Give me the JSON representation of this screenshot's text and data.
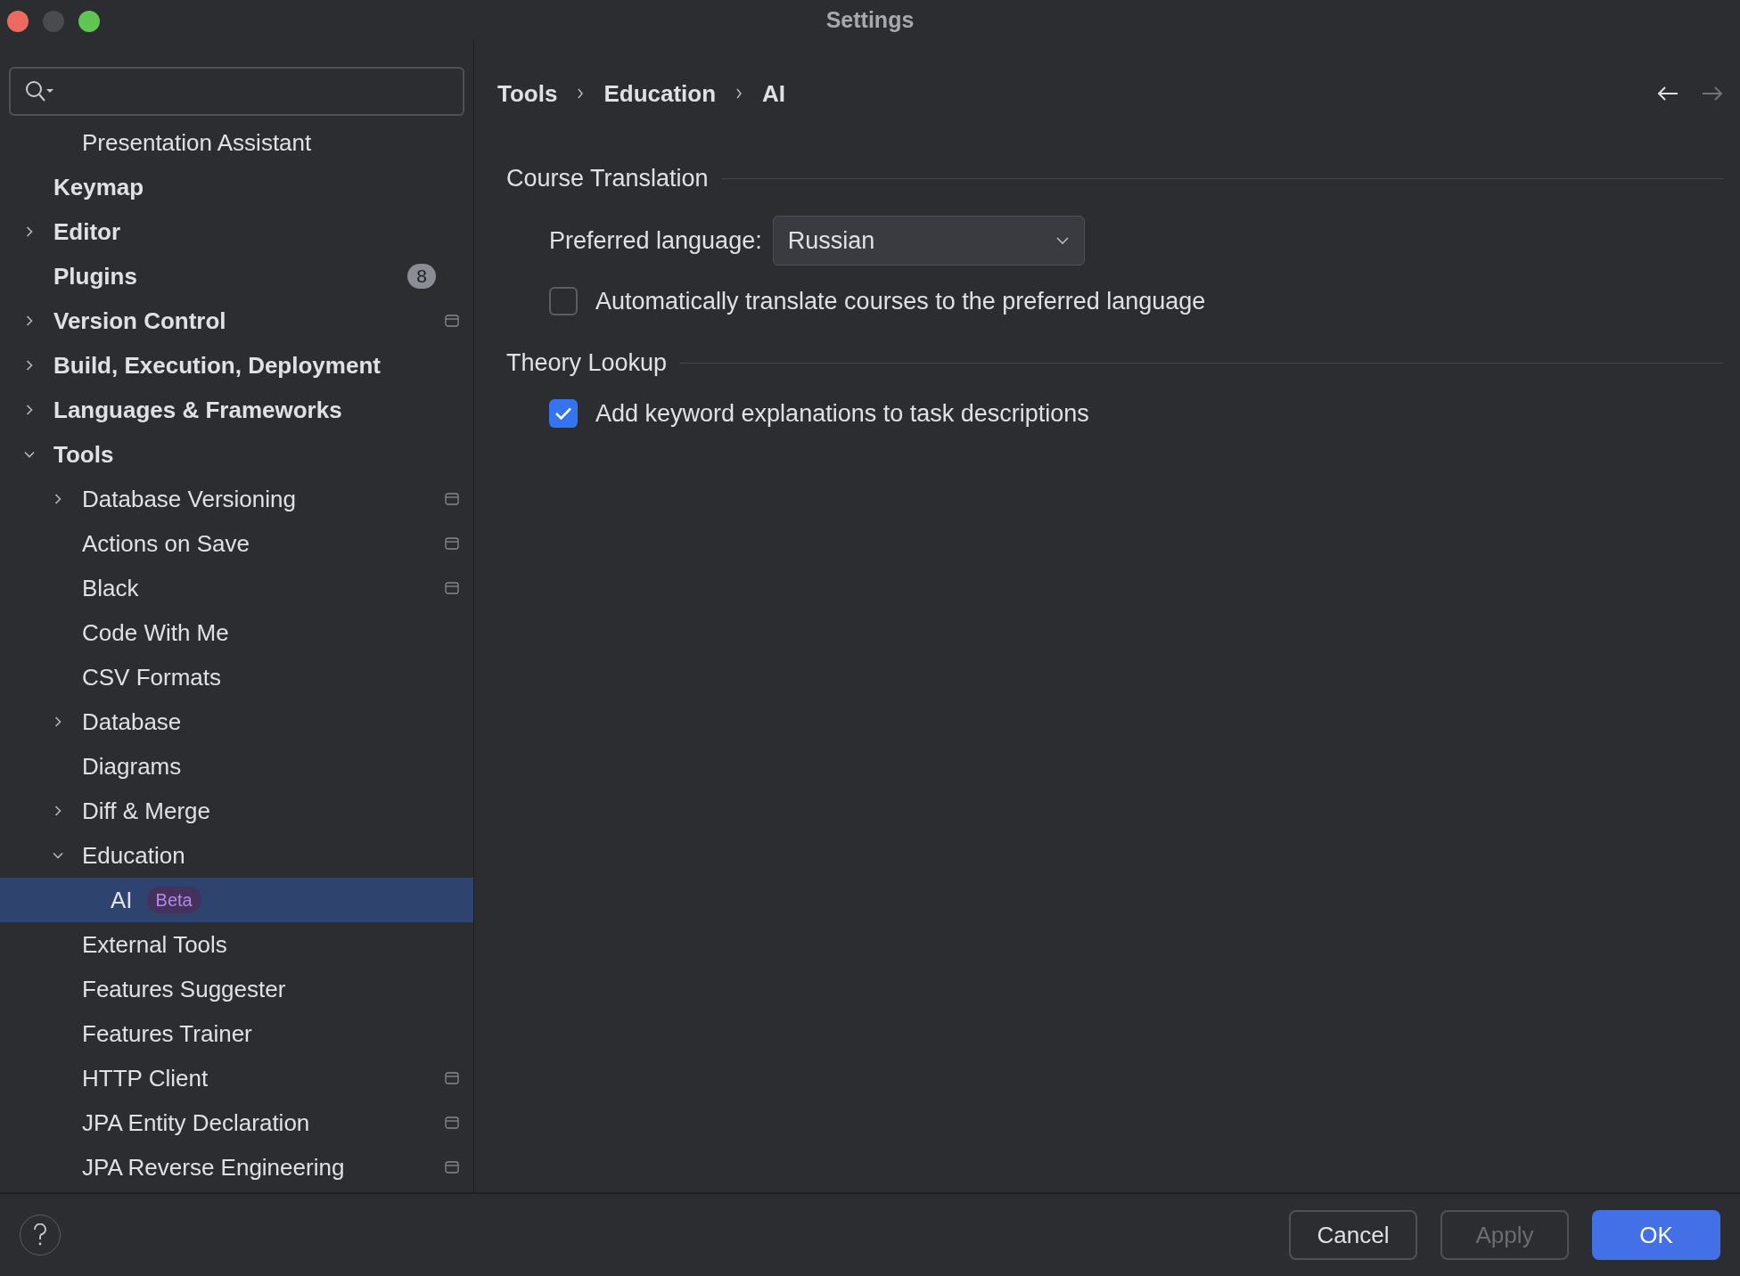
{
  "window": {
    "title": "Settings"
  },
  "tree_partial": [
    {
      "label": "Presentation Assistant",
      "selected": false
    }
  ],
  "tree": [
    {
      "label": "Keymap",
      "selected": false
    },
    {
      "label": "Editor",
      "selected": false,
      "expanded": false
    },
    {
      "label": "Plugins",
      "selected": false,
      "badge": "8"
    },
    {
      "label": "Version Control",
      "selected": false,
      "expanded": false,
      "project_level": true
    },
    {
      "label": "Build, Execution, Deployment",
      "selected": false,
      "expanded": false
    },
    {
      "label": "Languages & Frameworks",
      "selected": false,
      "expanded": false
    },
    {
      "label": "Tools",
      "selected": false,
      "expanded": true,
      "children": [
        {
          "label": "Database Versioning",
          "selected": false,
          "expanded": false,
          "project_level": true
        },
        {
          "label": "Actions on Save",
          "selected": false,
          "project_level": true
        },
        {
          "label": "Black",
          "selected": false,
          "project_level": true
        },
        {
          "label": "Code With Me",
          "selected": false
        },
        {
          "label": "CSV Formats",
          "selected": false
        },
        {
          "label": "Database",
          "selected": false,
          "expanded": false
        },
        {
          "label": "Diagrams",
          "selected": false
        },
        {
          "label": "Diff & Merge",
          "selected": false,
          "expanded": false
        },
        {
          "label": "Education",
          "selected": false,
          "expanded": true,
          "children": [
            {
              "label": "AI",
              "selected": true,
              "tag": "Beta"
            }
          ]
        },
        {
          "label": "External Tools",
          "selected": false
        },
        {
          "label": "Features Suggester",
          "selected": false
        },
        {
          "label": "Features Trainer",
          "selected": false
        },
        {
          "label": "HTTP Client",
          "selected": false,
          "project_level": true
        },
        {
          "label": "JPA Entity Declaration",
          "selected": false,
          "project_level": true
        },
        {
          "label": "JPA Reverse Engineering",
          "selected": false,
          "project_level": true
        }
      ]
    }
  ],
  "breadcrumb": [
    "Tools",
    "Education",
    "AI"
  ],
  "sections": [
    {
      "title": "Course Translation",
      "rows": [
        {
          "kind": "dropdown",
          "label": "Preferred language:",
          "value": "Russian"
        },
        {
          "kind": "checkbox",
          "label": "Automatically translate courses to the preferred language",
          "checked": false
        }
      ]
    },
    {
      "title": "Theory Lookup",
      "rows": [
        {
          "kind": "checkbox",
          "label": "Add keyword explanations to task descriptions",
          "checked": true
        }
      ]
    }
  ],
  "buttons": [
    {
      "label": "Cancel",
      "kind": "default",
      "disabled": false
    },
    {
      "label": "Apply",
      "kind": "default",
      "disabled": true
    },
    {
      "label": "OK",
      "kind": "primary",
      "disabled": false
    }
  ]
}
